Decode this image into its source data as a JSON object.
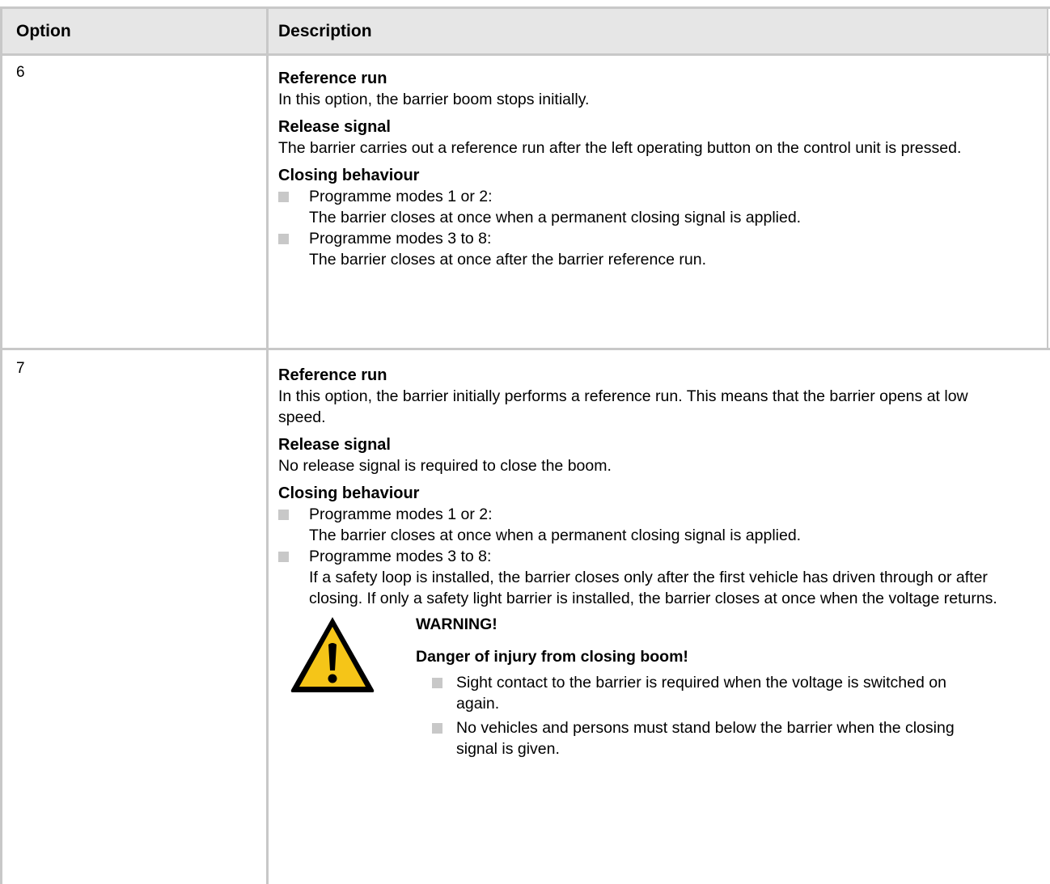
{
  "table": {
    "headers": {
      "option": "Option",
      "description": "Description"
    },
    "rows": [
      {
        "option": "6",
        "sections": [
          {
            "title": "Reference run",
            "text": "In this option, the barrier boom stops initially."
          },
          {
            "title": "Release signal",
            "text": "The barrier carries out a reference run after the left operating button on the control unit is pressed."
          },
          {
            "title": "Closing behaviour"
          }
        ],
        "bullets": [
          {
            "head": "Programme modes 1 or 2:",
            "text": "The barrier closes at once when a permanent closing signal is applied."
          },
          {
            "head": "Programme modes 3 to 8:",
            "text": "The barrier closes at once after the barrier reference run."
          }
        ]
      },
      {
        "option": "7",
        "sections": [
          {
            "title": "Reference run",
            "text": "In this option, the barrier initially performs a reference run. This means that the barrier opens at low speed."
          },
          {
            "title": "Release signal",
            "text": "No release signal is required to close the boom."
          },
          {
            "title": "Closing behaviour"
          }
        ],
        "bullets": [
          {
            "head": "Programme modes 1 or 2:",
            "text": "The barrier closes at once when a permanent closing signal is applied."
          },
          {
            "head": "Programme modes 3 to 8:",
            "text": "If a safety loop is installed, the barrier closes only after the first vehicle has driven through or after closing. If only a safety light barrier is installed, the barrier closes at once when the voltage returns."
          }
        ],
        "warning": {
          "icon": "warning-triangle-icon",
          "title": "WARNING!",
          "subtitle": "Danger of injury from closing boom!",
          "items": [
            "Sight contact to the barrier is required when the voltage is switched on again.",
            "No vehicles and persons must stand below the barrier when the closing signal is given."
          ]
        }
      }
    ]
  },
  "colors": {
    "grid": "#c8c8c8",
    "header_bg": "#e6e6e6",
    "bullet": "#c8c8c8",
    "warning_yellow": "#f5c518"
  }
}
